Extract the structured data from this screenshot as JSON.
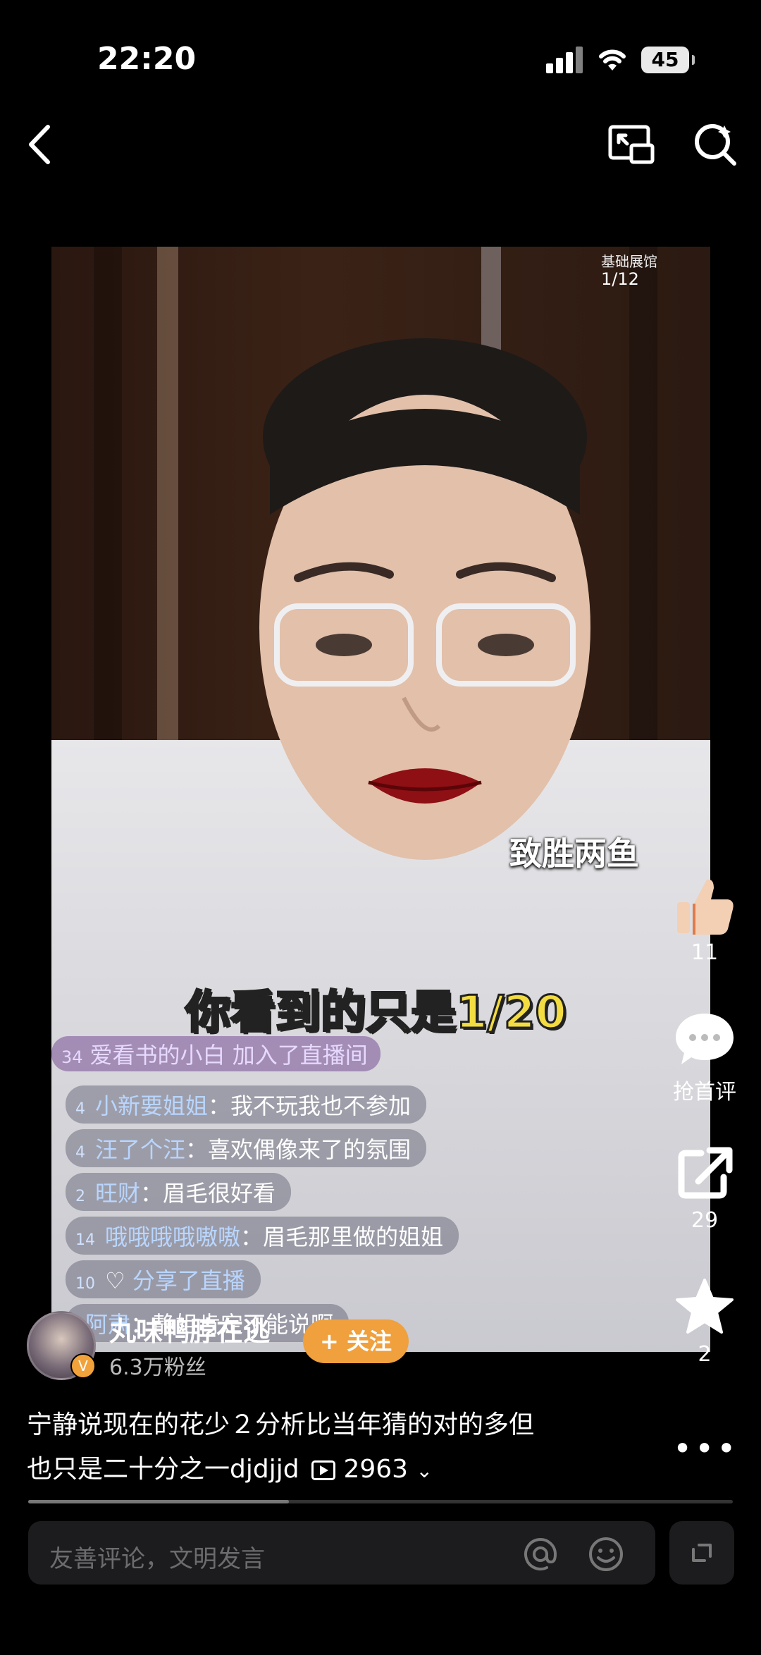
{
  "status_bar": {
    "time": "22:20",
    "battery": "45"
  },
  "video": {
    "exhibition_label": "基础展馆",
    "exhibition_page": "1/12",
    "sticker_text": "致胜两鱼",
    "subtitle": "你看到的只是1/20",
    "join_message": {
      "level": "34",
      "text": "爱看书的小白 加入了直播间"
    },
    "chat": [
      {
        "level": "4",
        "user": "小新要姐姐",
        "text": "我不玩我也不参加"
      },
      {
        "level": "4",
        "user": "汪了个汪",
        "text": "喜欢偶像来了的氛围"
      },
      {
        "level": "2",
        "user": "旺财",
        "text": "眉毛很好看"
      },
      {
        "level": "14",
        "user": "哦哦哦哦嗷嗷",
        "text": "眉毛那里做的姐姐"
      },
      {
        "level": "10",
        "user": "",
        "text": "分享了直播"
      },
      {
        "level": "",
        "user": "阿肃",
        "text": "静姐肯定不能说啊"
      }
    ]
  },
  "actions": {
    "like_count": "11",
    "comment_label": "抢首评",
    "share_count": "29",
    "favorite_count": "2"
  },
  "author": {
    "name": "丸味鸭脖在逃",
    "fans": "6.3万粉丝",
    "follow_label": "+ 关注"
  },
  "post": {
    "desc_line1": "宁静说现在的花少２分析比当年猜的对的多但",
    "desc_line2_text": "也只是二十分之一djdjjd",
    "play_count": "2963",
    "progress": 0.37
  },
  "comment_bar": {
    "placeholder": "友善评论，文明发言"
  }
}
